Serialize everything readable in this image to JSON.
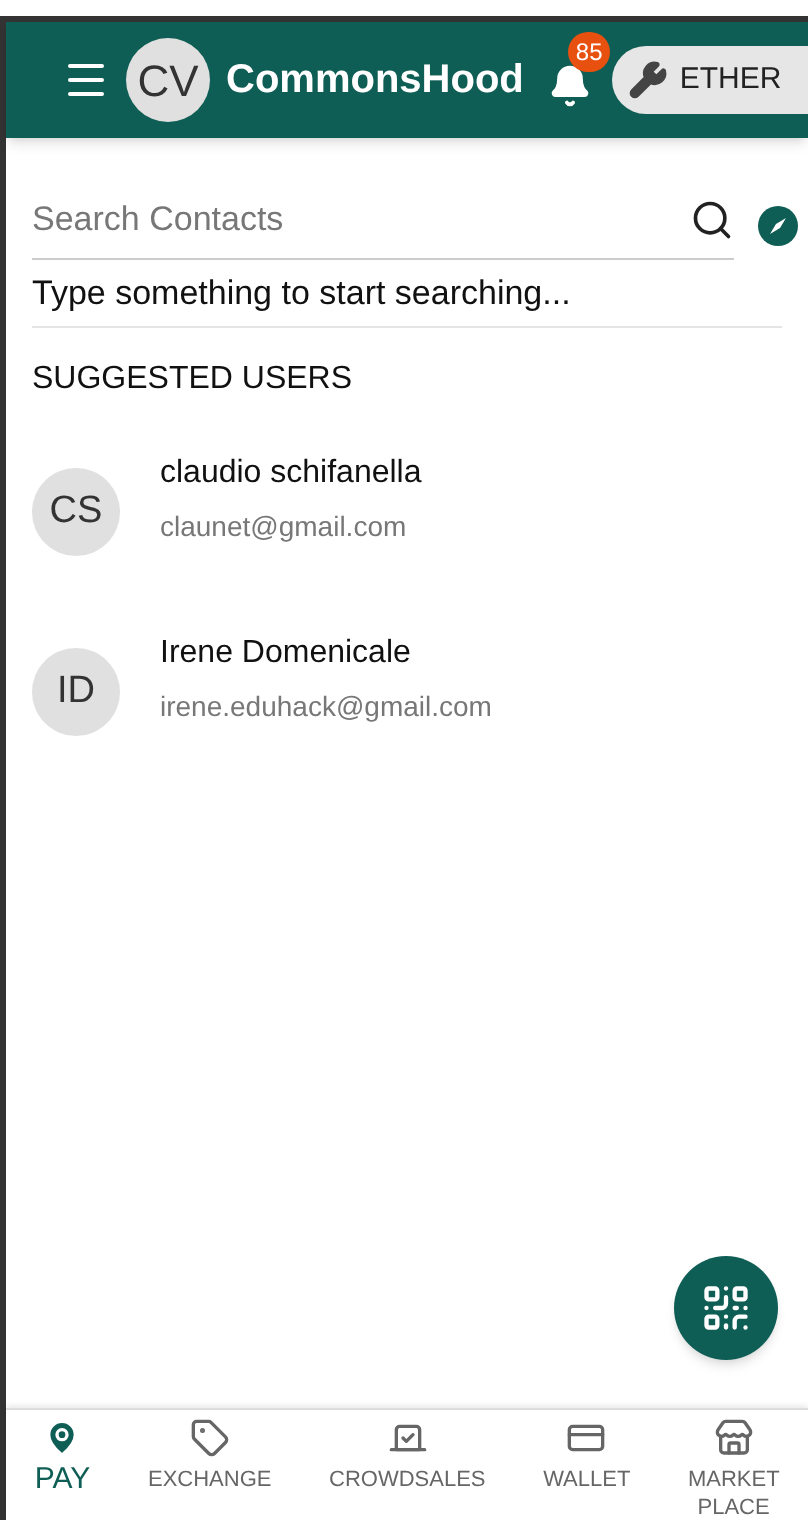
{
  "header": {
    "avatar": "CV",
    "title": "CommonsHood",
    "notification_count": "85",
    "network": "ETHER"
  },
  "search": {
    "placeholder": "Search Contacts",
    "hint": "Type something to start searching..."
  },
  "suggested": {
    "heading": "SUGGESTED USERS",
    "users": [
      {
        "initials": "CS",
        "name": "claudio schifanella",
        "email": "claunet@gmail.com"
      },
      {
        "initials": "ID",
        "name": "Irene Domenicale",
        "email": "irene.eduhack@gmail.com"
      }
    ]
  },
  "nav": [
    {
      "kind": "pin",
      "label": "PAY",
      "selected": true
    },
    {
      "kind": "tag",
      "label": "EXCHANGE",
      "selected": false
    },
    {
      "kind": "vote",
      "label": "CROWDSALES",
      "selected": false
    },
    {
      "kind": "card",
      "label": "WALLET",
      "selected": false
    },
    {
      "kind": "store",
      "label": "MARKET PLACE",
      "selected": false
    }
  ]
}
